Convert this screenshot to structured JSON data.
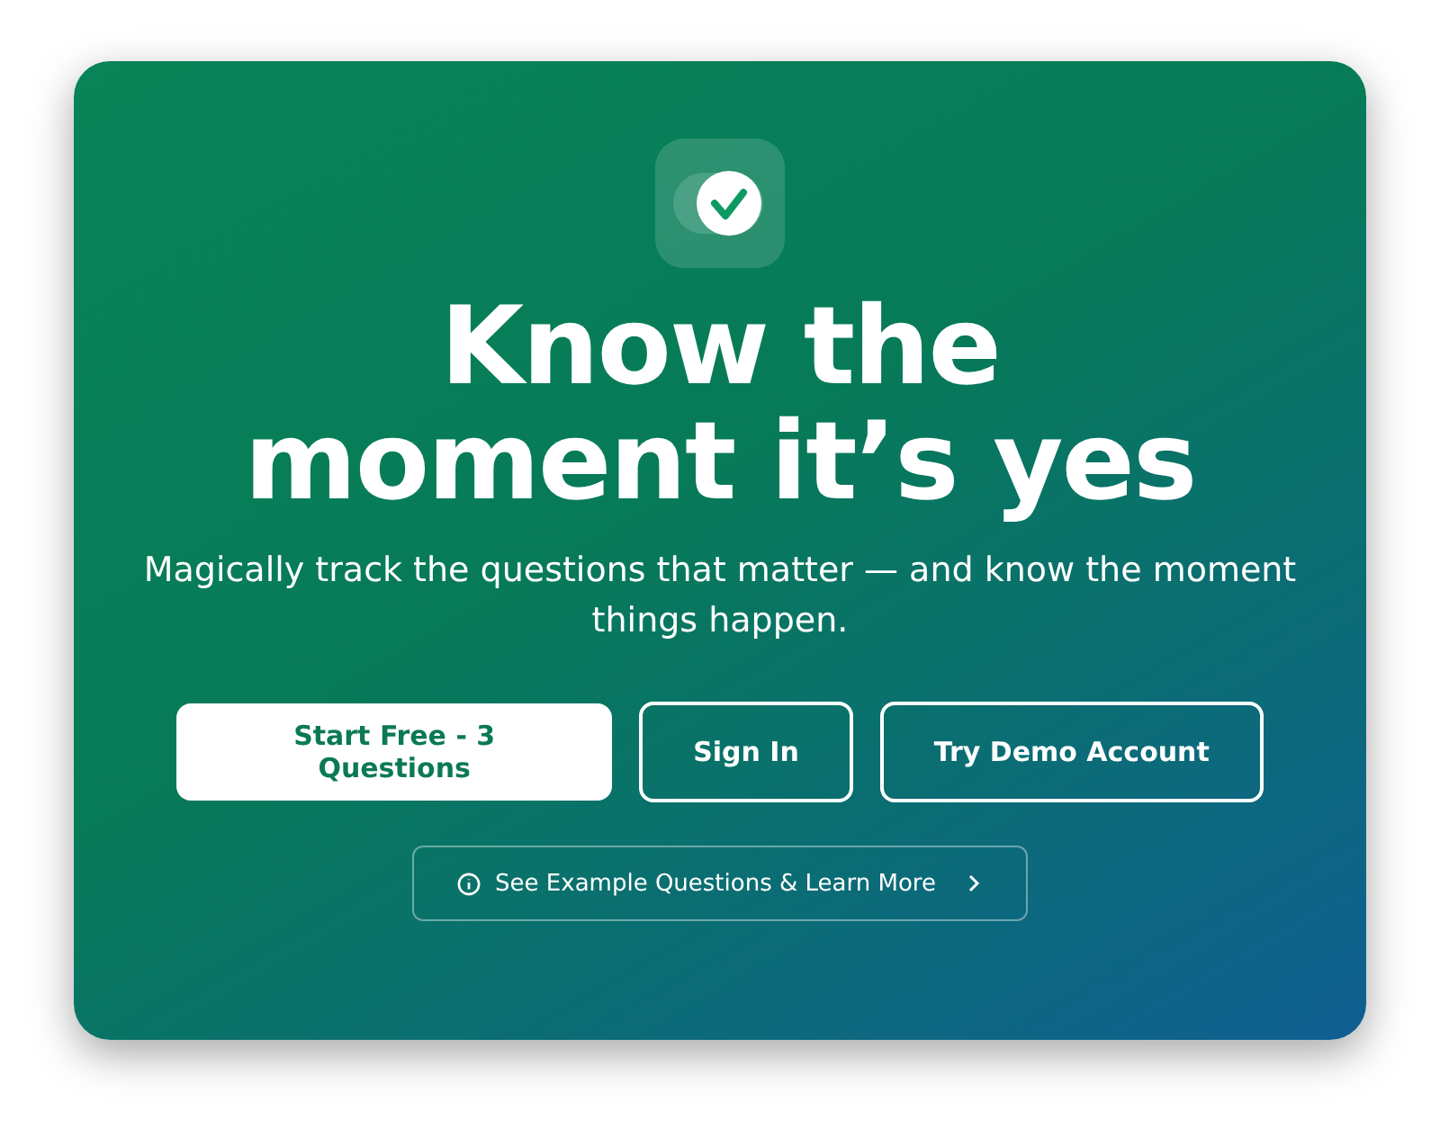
{
  "hero": {
    "title": "Know the moment it’s yes",
    "subtitle": "Magically track the questions that matter — and know the moment things happen."
  },
  "buttons": [
    {
      "label": "Start Free - 3 Questions",
      "kind": "primary"
    },
    {
      "label": "Sign In",
      "kind": "outline"
    },
    {
      "label": "Try Demo Account",
      "kind": "outline"
    }
  ],
  "learn_more": {
    "label": "See Example Questions & Learn More"
  }
}
